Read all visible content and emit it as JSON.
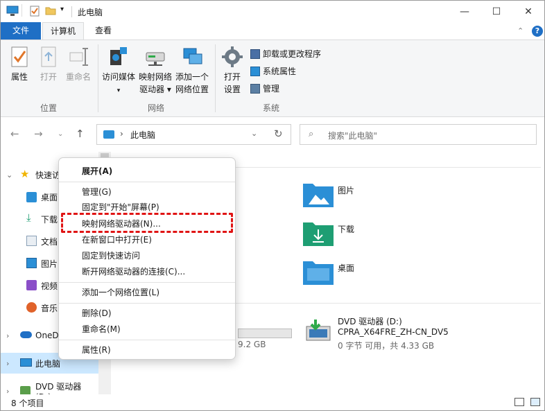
{
  "window": {
    "title": "此电脑",
    "controls": {
      "minimize": "—",
      "maximize": "☐",
      "close": "✕"
    }
  },
  "tabs": {
    "file": "文件",
    "computer": "计算机",
    "view": "查看"
  },
  "ribbon": {
    "groups": {
      "location": "位置",
      "network": "网络",
      "system": "系统"
    },
    "location_buttons": [
      {
        "label": "属性"
      },
      {
        "label": "打开"
      },
      {
        "label": "重命名"
      }
    ],
    "network_buttons": [
      {
        "label1": "访问媒体",
        "label2": "▾"
      },
      {
        "label1": "映射网络",
        "label2": "驱动器 ▾"
      },
      {
        "label1": "添加一个",
        "label2": "网络位置"
      }
    ],
    "system_big": {
      "label1": "打开",
      "label2": "设置"
    },
    "system_small": [
      {
        "label": "卸载或更改程序"
      },
      {
        "label": "系统属性"
      },
      {
        "label": "管理"
      }
    ]
  },
  "address": {
    "path": "此电脑",
    "chevron": "›"
  },
  "search": {
    "placeholder": "搜索\"此电脑\""
  },
  "nav_pane": {
    "items": [
      {
        "label": "快速访"
      },
      {
        "label": "桌面"
      },
      {
        "label": "下载"
      },
      {
        "label": "文档"
      },
      {
        "label": "图片"
      },
      {
        "label": "视频"
      },
      {
        "label": "音乐"
      },
      {
        "label": "OneD"
      },
      {
        "label": "此电脑"
      },
      {
        "label": "DVD 驱动器 (D:)"
      }
    ]
  },
  "content": {
    "folders": [
      {
        "label": "图片"
      },
      {
        "label": "下载"
      },
      {
        "label": "桌面"
      }
    ],
    "drive": {
      "name": "DVD 驱动器 (D:)",
      "volume": "CPRA_X64FRE_ZH-CN_DV5",
      "space": "0 字节 可用，共 4.33 GB"
    },
    "partial_drive_text": "9.2 GB"
  },
  "status": {
    "item_count": "8 个项目"
  },
  "context_menu": {
    "items": [
      {
        "label": "展开(A)"
      },
      {
        "label": "管理(G)"
      },
      {
        "label": "固定到\"开始\"屏幕(P)"
      },
      {
        "label": "映射网络驱动器(N)..."
      },
      {
        "label": "在新窗口中打开(E)"
      },
      {
        "label": "固定到快速访问"
      },
      {
        "label": "断开网络驱动器的连接(C)..."
      },
      {
        "label": "添加一个网络位置(L)"
      },
      {
        "label": "删除(D)"
      },
      {
        "label": "重命名(M)"
      },
      {
        "label": "属性(R)"
      }
    ]
  },
  "colors": {
    "accent": "#1f6fc5",
    "highlight_box": "#e01414",
    "folder_blue": "#2b8fd6",
    "folder_green": "#1e9e73"
  }
}
